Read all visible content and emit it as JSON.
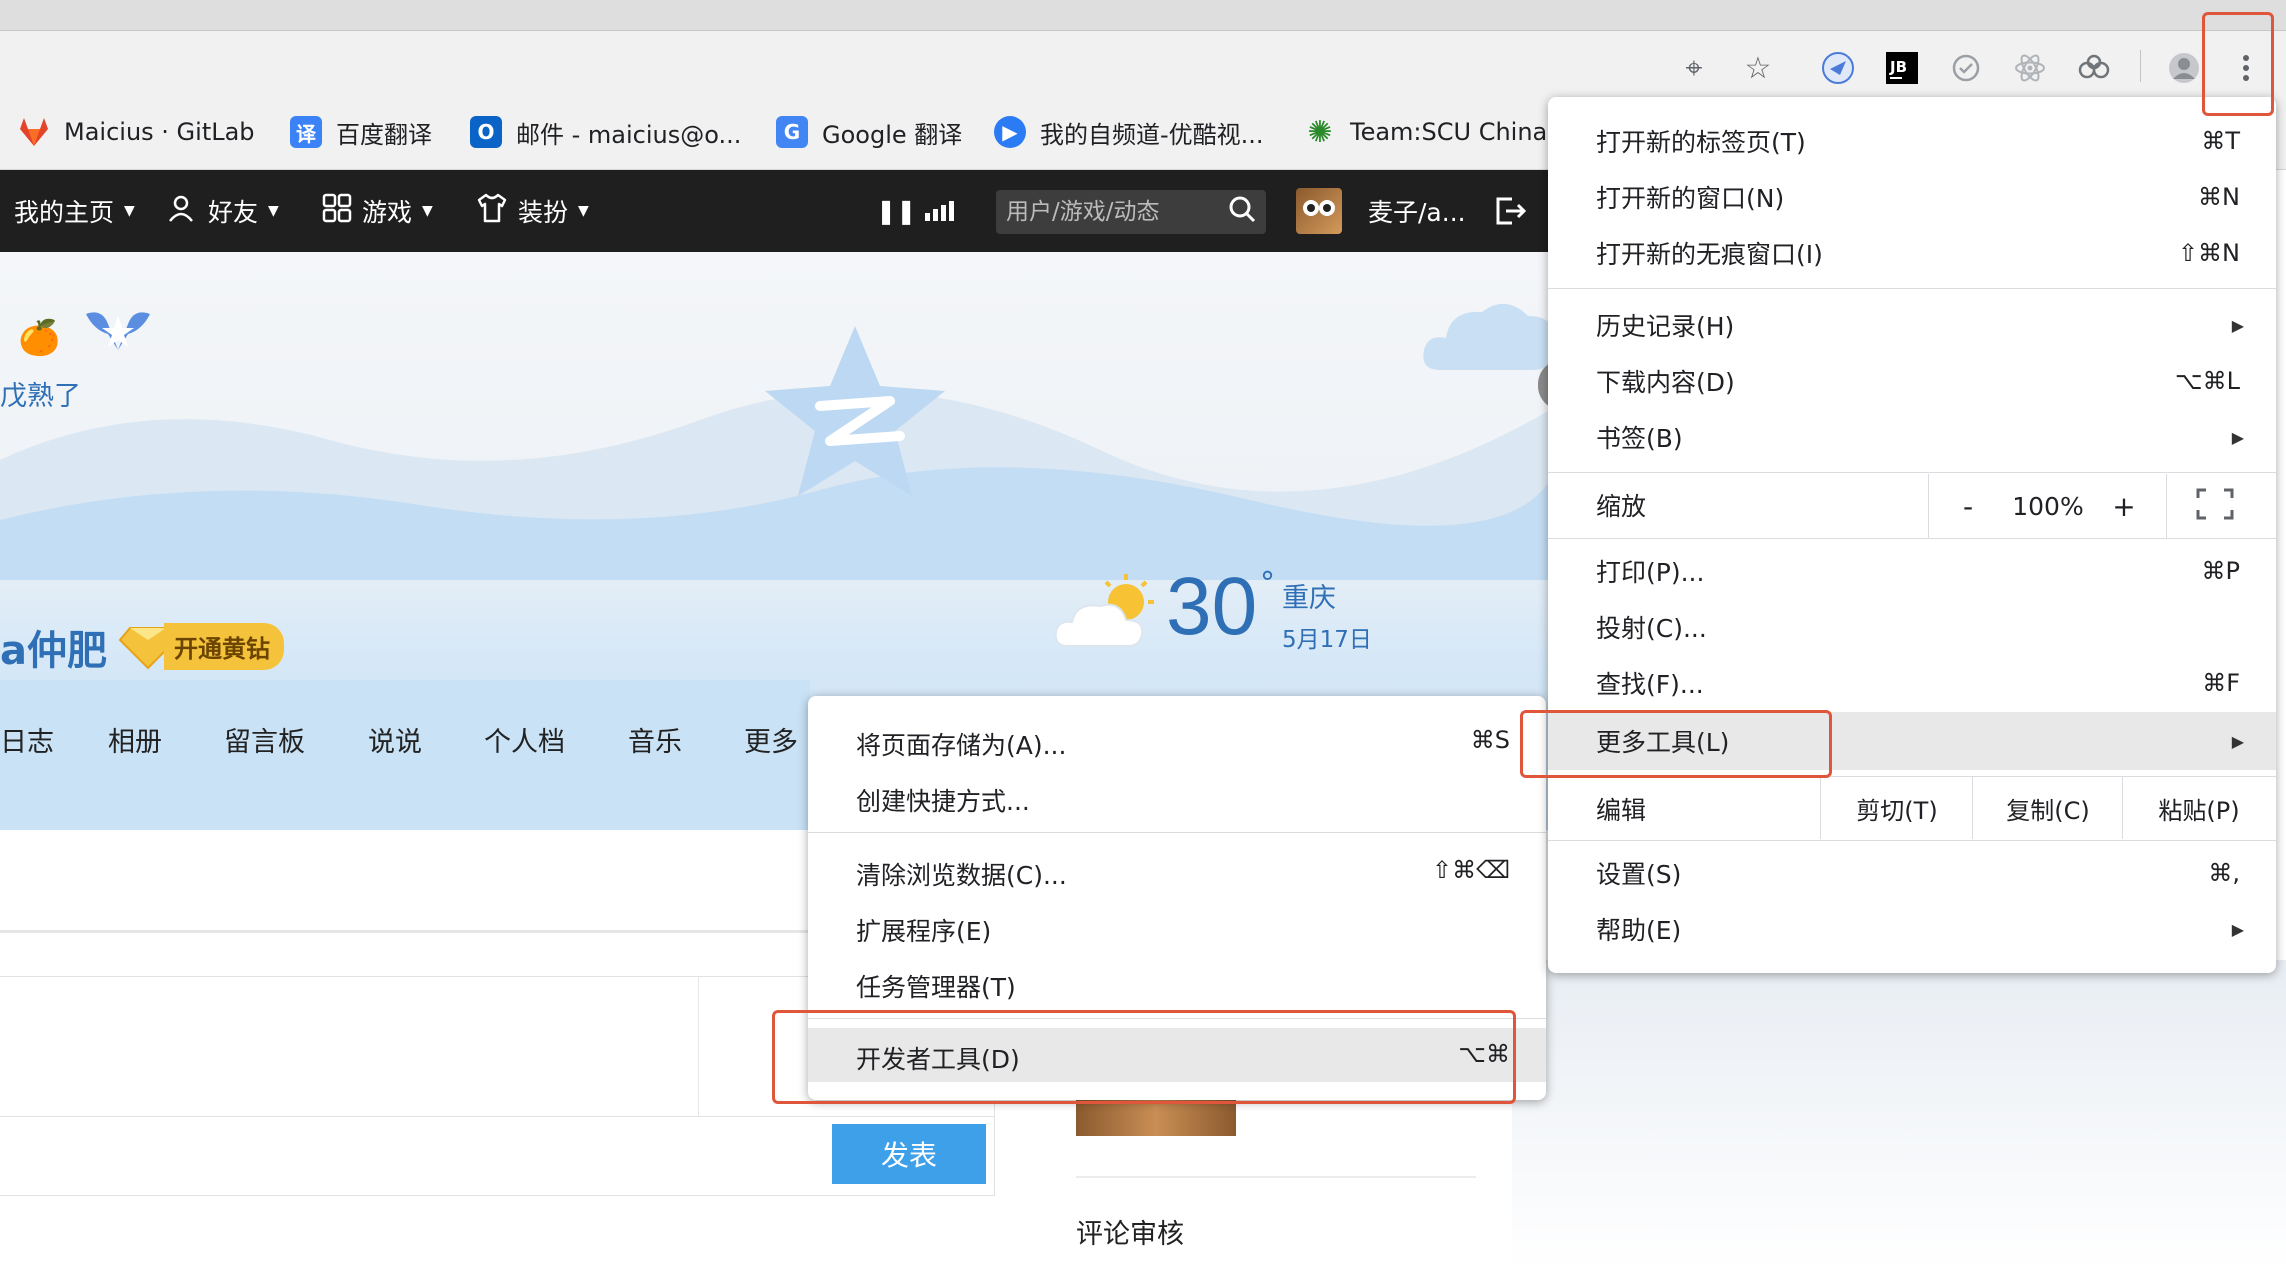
{
  "bookmarks": [
    {
      "label": "Maicius · GitLab",
      "icon": "gitlab-icon",
      "color": "#e24329"
    },
    {
      "label": "百度翻译",
      "icon": "baidu-translate-icon",
      "color": "#3b82f6",
      "glyph": "译"
    },
    {
      "label": "邮件 - maicius@o...",
      "icon": "outlook-icon",
      "color": "#0a64c8",
      "glyph": "O"
    },
    {
      "label": "Google 翻译",
      "icon": "google-translate-icon",
      "color": "#4285f4",
      "glyph": "G"
    },
    {
      "label": "我的自频道-优酷视...",
      "icon": "youku-icon",
      "color": "#2b7cf4",
      "glyph": "▶"
    },
    {
      "label": "Team:SCU China",
      "icon": "igem-icon",
      "color": "#2a8a2a",
      "glyph": "✺"
    }
  ],
  "qzone_nav": {
    "home": "我的主页",
    "friends": "好友",
    "games": "游戏",
    "dressup": "装扮",
    "search_placeholder": "用户/游戏/动态",
    "username": "麦子/a..."
  },
  "banner": {
    "nickname_fragment": "戊熟了",
    "name_fragment": "a仲肥",
    "vip_button": "开通黄钻",
    "weather_temp": "30",
    "weather_unit": "°",
    "weather_city": "重庆",
    "weather_date": "5月17日"
  },
  "page_tabs": [
    "日志",
    "相册",
    "留言板",
    "说说",
    "个人档",
    "音乐",
    "更多"
  ],
  "content": {
    "post_button": "发表",
    "review_label": "评论审核"
  },
  "main_menu": {
    "new_tab": {
      "label": "打开新的标签页(T)",
      "shortcut": "⌘T"
    },
    "new_window": {
      "label": "打开新的窗口(N)",
      "shortcut": "⌘N"
    },
    "new_incognito": {
      "label": "打开新的无痕窗口(I)",
      "shortcut": "⇧⌘N"
    },
    "history": {
      "label": "历史记录(H)"
    },
    "downloads": {
      "label": "下载内容(D)",
      "shortcut": "⌥⌘L"
    },
    "bookmarks": {
      "label": "书签(B)"
    },
    "zoom": {
      "label": "缩放",
      "minus": "-",
      "value": "100%",
      "plus": "+"
    },
    "print": {
      "label": "打印(P)...",
      "shortcut": "⌘P"
    },
    "cast": {
      "label": "投射(C)..."
    },
    "find": {
      "label": "查找(F)...",
      "shortcut": "⌘F"
    },
    "more_tools": {
      "label": "更多工具(L)"
    },
    "edit": {
      "label": "编辑",
      "cut": "剪切(T)",
      "copy": "复制(C)",
      "paste": "粘贴(P)"
    },
    "settings": {
      "label": "设置(S)",
      "shortcut": "⌘,"
    },
    "help": {
      "label": "帮助(E)"
    }
  },
  "sub_menu": {
    "save_page": {
      "label": "将页面存储为(A)...",
      "shortcut": "⌘S"
    },
    "create_shortcut": {
      "label": "创建快捷方式..."
    },
    "clear_data": {
      "label": "清除浏览数据(C)...",
      "shortcut": "⇧⌘⌫"
    },
    "extensions": {
      "label": "扩展程序(E)"
    },
    "task_manager": {
      "label": "任务管理器(T)"
    },
    "dev_tools": {
      "label": "开发者工具(D)",
      "shortcut": "⌥⌘"
    }
  },
  "colors": {
    "highlight": "#e0563a",
    "qzone_nav_bg": "#1f1f1f",
    "post_button": "#3fa0ea",
    "vip_gold": "#f5c33b"
  }
}
